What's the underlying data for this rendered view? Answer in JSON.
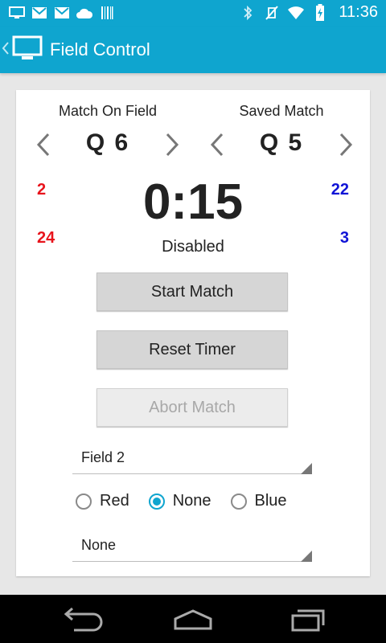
{
  "status_bar": {
    "time": "11:36",
    "left_icons": [
      "monitor-icon",
      "gmail-icon",
      "gmail-icon",
      "cloud-icon",
      "barcode-icon"
    ],
    "right_icons": [
      "bluetooth-icon",
      "vibrate-off-icon",
      "wifi-icon",
      "battery-charging-icon"
    ]
  },
  "action_bar": {
    "title": "Field Control",
    "app_icon": "monitor-icon"
  },
  "match": {
    "on_field_label": "Match On Field",
    "on_field_value": "Q 6",
    "saved_label": "Saved Match",
    "saved_value": "Q 5"
  },
  "teams": {
    "red": [
      "2",
      "24"
    ],
    "blue": [
      "22",
      "3"
    ]
  },
  "timer": {
    "value": "0:15",
    "status": "Disabled"
  },
  "buttons": {
    "start": "Start Match",
    "reset": "Reset Timer",
    "abort": "Abort Match"
  },
  "field_spinner": {
    "value": "Field 2"
  },
  "alliance_radio": {
    "options": [
      "Red",
      "None",
      "Blue"
    ],
    "selected": "None"
  },
  "mode_spinner": {
    "value": "None"
  },
  "colors": {
    "accent": "#0fa5cf",
    "red_team": "#e8141c",
    "blue_team": "#1114d6"
  }
}
